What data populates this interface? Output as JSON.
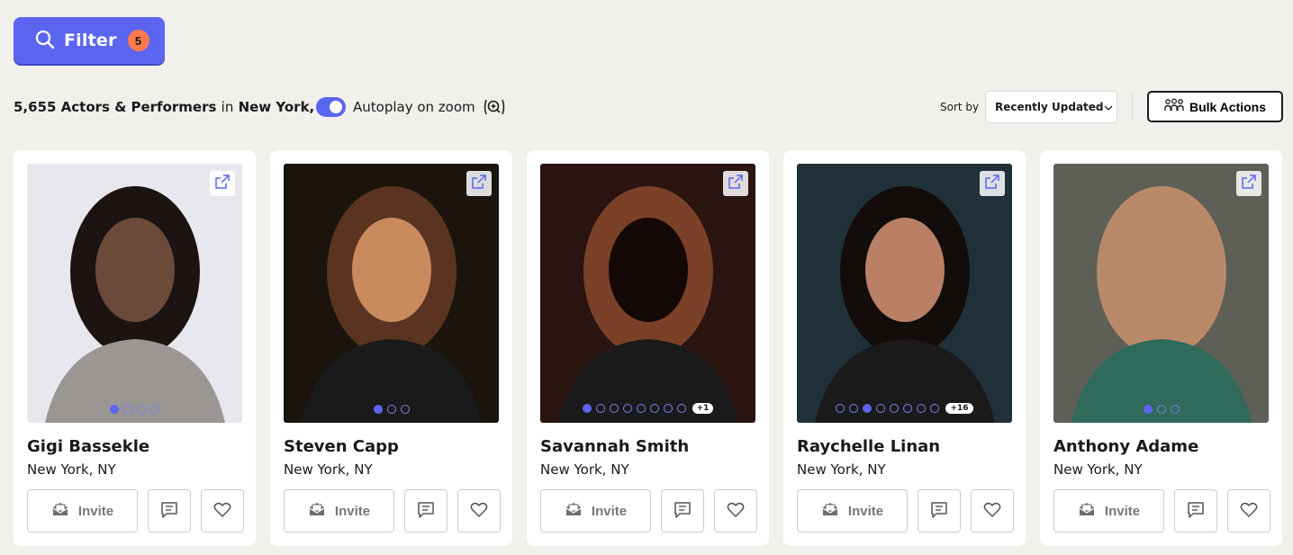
{
  "filter": {
    "label": "Filter",
    "count": "5",
    "icon": "search-icon"
  },
  "results": {
    "count": "5,655 Actors & Performers",
    "in": "in",
    "location": "New York, NY"
  },
  "autoplay": {
    "label": "Autoplay on zoom",
    "enabled": true,
    "icon": "zoom-in-icon"
  },
  "sort": {
    "label": "Sort by",
    "selected": "Recently Updated"
  },
  "bulk": {
    "label": "Bulk Actions",
    "icon": "bulk-people-icon"
  },
  "colors": {
    "accent": "#5b66f0",
    "badge": "#ff7a4d",
    "background": "#f2f0ec"
  },
  "cards": [
    {
      "name": "Gigi Bassekle",
      "location": "New York, NY",
      "invite": "Invite",
      "dots": 4,
      "active_dot": 0,
      "more": "",
      "palette": [
        "#e9e7ee",
        "#1c1412",
        "#6b4a3a"
      ]
    },
    {
      "name": "Steven Capp",
      "location": "New York, NY",
      "invite": "Invite",
      "dots": 3,
      "active_dot": 0,
      "more": "",
      "palette": [
        "#1a140c",
        "#c98a5e",
        "#5a3420"
      ]
    },
    {
      "name": "Savannah Smith",
      "location": "New York, NY",
      "invite": "Invite",
      "dots": 8,
      "active_dot": 0,
      "more": "+1",
      "palette": [
        "#2a1410",
        "#7a4028",
        "#140806"
      ]
    },
    {
      "name": "Raychelle Linan",
      "location": "New York, NY",
      "invite": "Invite",
      "dots": 8,
      "active_dot": 2,
      "more": "+16",
      "palette": [
        "#203038",
        "#b98065",
        "#120c0a"
      ]
    },
    {
      "name": "Anthony Adame",
      "location": "New York, NY",
      "invite": "Invite",
      "dots": 3,
      "active_dot": 0,
      "more": "",
      "palette": [
        "#5e6058",
        "#b98a6a",
        "#2f6a5a"
      ]
    }
  ]
}
